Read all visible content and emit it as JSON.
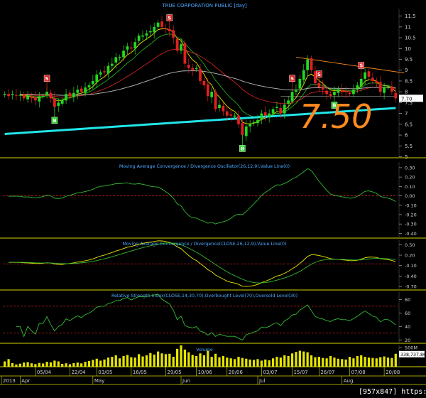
{
  "chart_data": {
    "title": "TRUE CORPORATION PUBLIC [day]",
    "type": "candlestick",
    "dates": [
      "2013-03-26",
      "2013-03-27",
      "2013-03-28",
      "2013-04-01",
      "2013-04-02",
      "2013-04-03",
      "2013-04-04",
      "2013-04-05",
      "2013-04-08",
      "2013-04-09",
      "2013-04-10",
      "2013-04-11",
      "2013-04-12",
      "2013-04-17",
      "2013-04-18",
      "2013-04-19",
      "2013-04-22",
      "2013-04-23",
      "2013-04-24",
      "2013-04-25",
      "2013-04-26",
      "2013-04-29",
      "2013-04-30",
      "2013-05-02",
      "2013-05-03",
      "2013-05-06",
      "2013-05-07",
      "2013-05-08",
      "2013-05-09",
      "2013-05-10",
      "2013-05-13",
      "2013-05-14",
      "2013-05-15",
      "2013-05-16",
      "2013-05-17",
      "2013-05-20",
      "2013-05-21",
      "2013-05-22",
      "2013-05-23",
      "2013-05-24",
      "2013-05-27",
      "2013-05-28",
      "2013-05-29",
      "2013-05-30",
      "2013-05-31",
      "2013-06-03",
      "2013-06-04",
      "2013-06-05",
      "2013-06-06",
      "2013-06-07",
      "2013-06-10",
      "2013-06-11",
      "2013-06-12",
      "2013-06-13",
      "2013-06-14",
      "2013-06-17",
      "2013-06-18",
      "2013-06-19",
      "2013-06-20",
      "2013-06-21",
      "2013-06-24",
      "2013-06-25",
      "2013-06-26",
      "2013-06-27",
      "2013-06-28",
      "2013-07-01",
      "2013-07-02",
      "2013-07-03",
      "2013-07-04",
      "2013-07-05",
      "2013-07-08",
      "2013-07-09",
      "2013-07-10",
      "2013-07-11",
      "2013-07-12",
      "2013-07-15",
      "2013-07-16",
      "2013-07-17",
      "2013-07-18",
      "2013-07-19",
      "2013-07-24",
      "2013-07-25",
      "2013-07-26",
      "2013-07-29",
      "2013-07-30",
      "2013-07-31",
      "2013-08-01",
      "2013-08-02",
      "2013-08-05",
      "2013-08-06",
      "2013-08-07",
      "2013-08-08",
      "2013-08-09",
      "2013-08-13",
      "2013-08-14",
      "2013-08-15",
      "2013-08-16",
      "2013-08-19",
      "2013-08-20",
      "2013-08-21",
      "2013-08-22",
      "2013-08-23",
      "2013-08-26"
    ],
    "close": [
      7.9,
      7.8,
      7.9,
      7.85,
      7.85,
      7.7,
      7.8,
      7.7,
      7.6,
      7.8,
      7.8,
      8.0,
      7.7,
      7.3,
      7.5,
      7.6,
      7.9,
      7.8,
      7.95,
      8.1,
      8.0,
      8.2,
      8.3,
      8.5,
      8.8,
      8.9,
      8.9,
      9.2,
      9.3,
      9.6,
      9.6,
      9.9,
      10.1,
      10.0,
      10.3,
      10.6,
      10.6,
      10.7,
      10.8,
      11.0,
      11.2,
      11.0,
      10.9,
      10.8,
      10.5,
      9.9,
      10.2,
      9.3,
      9.1,
      9.0,
      9.1,
      8.5,
      8.3,
      7.8,
      8.0,
      7.2,
      7.4,
      7.1,
      6.9,
      6.9,
      6.9,
      6.5,
      6.0,
      6.4,
      6.5,
      6.6,
      6.7,
      7.0,
      6.9,
      7.0,
      7.2,
      7.3,
      7.0,
      7.4,
      7.6,
      8.0,
      8.1,
      8.6,
      9.0,
      9.5,
      9.0,
      8.4,
      8.2,
      8.1,
      7.9,
      7.8,
      8.0,
      8.1,
      8.0,
      8.0,
      7.9,
      8.1,
      8.3,
      8.6,
      8.9,
      8.7,
      8.5,
      8.4,
      8.0,
      8.2,
      8.2,
      8.0,
      7.7
    ],
    "y_axis_ticks": [
      5,
      5.5,
      6,
      6.5,
      7,
      7.5,
      8,
      8.5,
      9,
      9.5,
      10,
      10.5,
      11,
      11.5
    ],
    "ylim": [
      4.95,
      11.85
    ],
    "last_price_label": "7.70",
    "annotation": "7.50",
    "signals": [
      {
        "type": "S",
        "index": 11
      },
      {
        "type": "B",
        "index": 13
      },
      {
        "type": "S",
        "index": 43
      },
      {
        "type": "B",
        "index": 62
      },
      {
        "type": "S",
        "index": 75
      },
      {
        "type": "S",
        "index": 82
      },
      {
        "type": "B",
        "index": 86
      },
      {
        "type": "S",
        "index": 93
      }
    ],
    "overlays": [
      {
        "kind": "ema",
        "period": 5,
        "color": "#e6e600"
      },
      {
        "kind": "ema",
        "period": 10,
        "color": "#22aa22"
      },
      {
        "kind": "ema",
        "period": 25,
        "color": "#cc2222"
      },
      {
        "kind": "ema",
        "period": 75,
        "color": "#bbbbbb"
      },
      {
        "kind": "linear",
        "start_index": 0,
        "end_index": 102,
        "start_value": 6.05,
        "end_value": 7.25,
        "color": "#22e5e8"
      }
    ],
    "trendline": {
      "start_index": 76,
      "start_value": 9.6,
      "end_index": 102,
      "end_value": 8.9,
      "color": "#ff8c1a"
    },
    "reference_line": {
      "start_index": 72,
      "end_index": 102,
      "value": 7.8,
      "color": "#bbbbbb"
    },
    "panels": [
      {
        "title": "Moving Average Convergence / Divergence Oscillator(26,12,9),Value Line(0)",
        "ticks": [
          "0.30",
          "0.20",
          "0.10",
          "0.00",
          "-0.10",
          "-0.20",
          "-0.30",
          "-0.40"
        ],
        "tick_values": [
          0.3,
          0.2,
          0.1,
          0.0,
          -0.1,
          -0.2,
          -0.3,
          -0.4
        ],
        "ylim": [
          -0.45,
          0.36
        ],
        "reference_value": 0,
        "line_color": "#33bb33"
      },
      {
        "title": "Moving Average Convergence / Divergence(CLOSE,26,12,9),Value Line(0)",
        "ticks": [
          "0.50",
          "0.20",
          "-0.10",
          "-0.40",
          "-0.70"
        ],
        "tick_values": [
          0.5,
          0.2,
          -0.1,
          -0.4,
          -0.7
        ],
        "ylim": [
          -0.8,
          0.65
        ],
        "reference_value": -0.05,
        "macd_color": "#e6e600",
        "signal_color": "#33bb33"
      },
      {
        "title": "Relative Strength Index(CLOSE,14,30,70),Overbought Level(70),Oversold Level(30)",
        "ticks": [
          "80",
          "60",
          "40",
          "20"
        ],
        "tick_values": [
          80,
          60,
          40,
          20
        ],
        "ylim": [
          15,
          92
        ],
        "overbought": 70,
        "oversold": 30,
        "line_color": "#33bb33"
      },
      {
        "title": "Volume",
        "ticks": [
          "500M"
        ],
        "tick_values": [
          500
        ],
        "ylim": [
          0,
          560
        ],
        "last_value_label": "338,737,86",
        "bar_color": "#e6e600",
        "volumes": [
          140,
          200,
          95,
          60,
          80,
          110,
          120,
          90,
          70,
          100,
          85,
          130,
          115,
          160,
          140,
          75,
          90,
          65,
          95,
          110,
          88,
          130,
          150,
          180,
          210,
          160,
          190,
          240,
          260,
          300,
          220,
          280,
          310,
          250,
          240,
          330,
          270,
          300,
          360,
          320,
          400,
          350,
          330,
          340,
          260,
          470,
          560,
          450,
          380,
          310,
          280,
          350,
          300,
          420,
          260,
          340,
          250,
          280,
          240,
          220,
          200,
          260,
          230,
          210,
          190,
          180,
          200,
          160,
          190,
          170,
          220,
          260,
          240,
          300,
          280,
          350,
          390,
          420,
          400,
          380,
          300,
          250,
          260,
          230,
          220,
          280,
          240,
          210,
          200,
          190,
          260,
          220,
          280,
          300,
          260,
          240,
          230,
          220,
          250,
          270,
          240,
          230,
          340
        ]
      }
    ],
    "x_axis_labels": [
      {
        "label": "05/04",
        "index": 8
      },
      {
        "label": "22/04",
        "index": 17
      },
      {
        "label": "03/05",
        "index": 24
      },
      {
        "label": "16/05",
        "index": 33
      },
      {
        "label": "29/05",
        "index": 42
      },
      {
        "label": "10/06",
        "index": 50
      },
      {
        "label": "20/06",
        "index": 58
      },
      {
        "label": "03/07",
        "index": 67
      },
      {
        "label": "15/07",
        "index": 75
      },
      {
        "label": "26/07",
        "index": 82
      },
      {
        "label": "07/08",
        "index": 90
      },
      {
        "label": "20/08",
        "index": 99
      }
    ],
    "x_axis_months": [
      {
        "label": "2013",
        "index": 0
      },
      {
        "label": "Apr",
        "index": 4
      },
      {
        "label": "May",
        "index": 23
      },
      {
        "label": "Jun",
        "index": 46
      },
      {
        "label": "Jul",
        "index": 66
      },
      {
        "label": "Aug",
        "index": 88
      }
    ]
  },
  "footer": {
    "dimension_label": "[957x847]",
    "url": "https://upic.me/"
  }
}
